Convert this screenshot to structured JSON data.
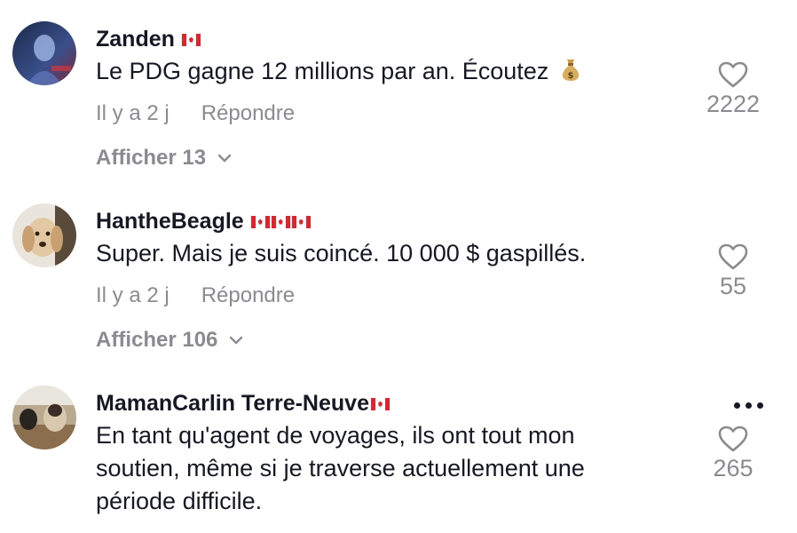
{
  "comments": [
    {
      "username": "Zanden",
      "flag_count": 1,
      "text": "Le PDG gagne 12 millions par an. Écoutez",
      "emoji": "money-bag",
      "time": "Il y a 2 j",
      "reply_label": "Répondre",
      "view_more": "Afficher 13",
      "likes": "2222"
    },
    {
      "username": "HantheBeagle",
      "flag_count": 3,
      "text": "Super. Mais je suis coincé. 10 000 $ gaspillés.",
      "time": "Il y a 2 j",
      "reply_label": "Répondre",
      "view_more": "Afficher 106",
      "likes": "55"
    },
    {
      "username": "MamanCarlin Terre-Neuve",
      "flag_count": 1,
      "text": "En tant qu'agent de voyages, ils ont tout mon soutien, même si je traverse actuellement une période difficile.",
      "likes": "265"
    }
  ],
  "colors": {
    "text_primary": "#161823",
    "text_secondary": "#8a8b91",
    "flag_red": "#e0242d"
  }
}
